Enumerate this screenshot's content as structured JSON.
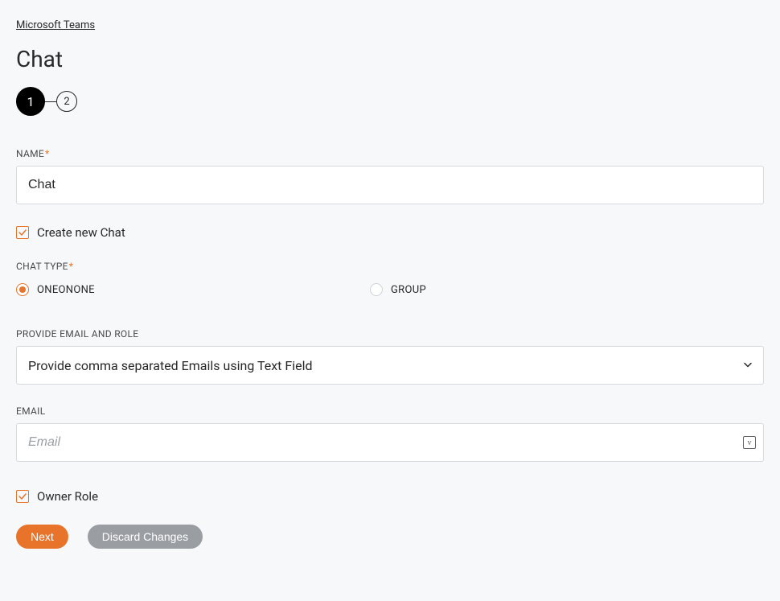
{
  "breadcrumb": {
    "label": "Microsoft Teams"
  },
  "page": {
    "title": "Chat"
  },
  "stepper": {
    "steps": [
      "1",
      "2"
    ],
    "active_index": 0
  },
  "form": {
    "name_label": "NAME",
    "name_value": "Chat",
    "create_new_label": "Create new Chat",
    "create_new_checked": true,
    "chat_type_label": "CHAT TYPE",
    "chat_type_options": {
      "oneonone": "ONEONONE",
      "group": "GROUP"
    },
    "chat_type_selected": "oneonone",
    "provide_label": "PROVIDE EMAIL AND ROLE",
    "provide_value": "Provide comma separated Emails using Text Field",
    "email_label": "EMAIL",
    "email_placeholder": "Email",
    "email_value": "",
    "owner_role_label": "Owner Role",
    "owner_role_checked": true
  },
  "buttons": {
    "next": "Next",
    "discard": "Discard Changes"
  },
  "colors": {
    "accent": "#e8742c",
    "bg": "#f7f8f9",
    "text": "#272727",
    "border": "#d7d9dc"
  }
}
